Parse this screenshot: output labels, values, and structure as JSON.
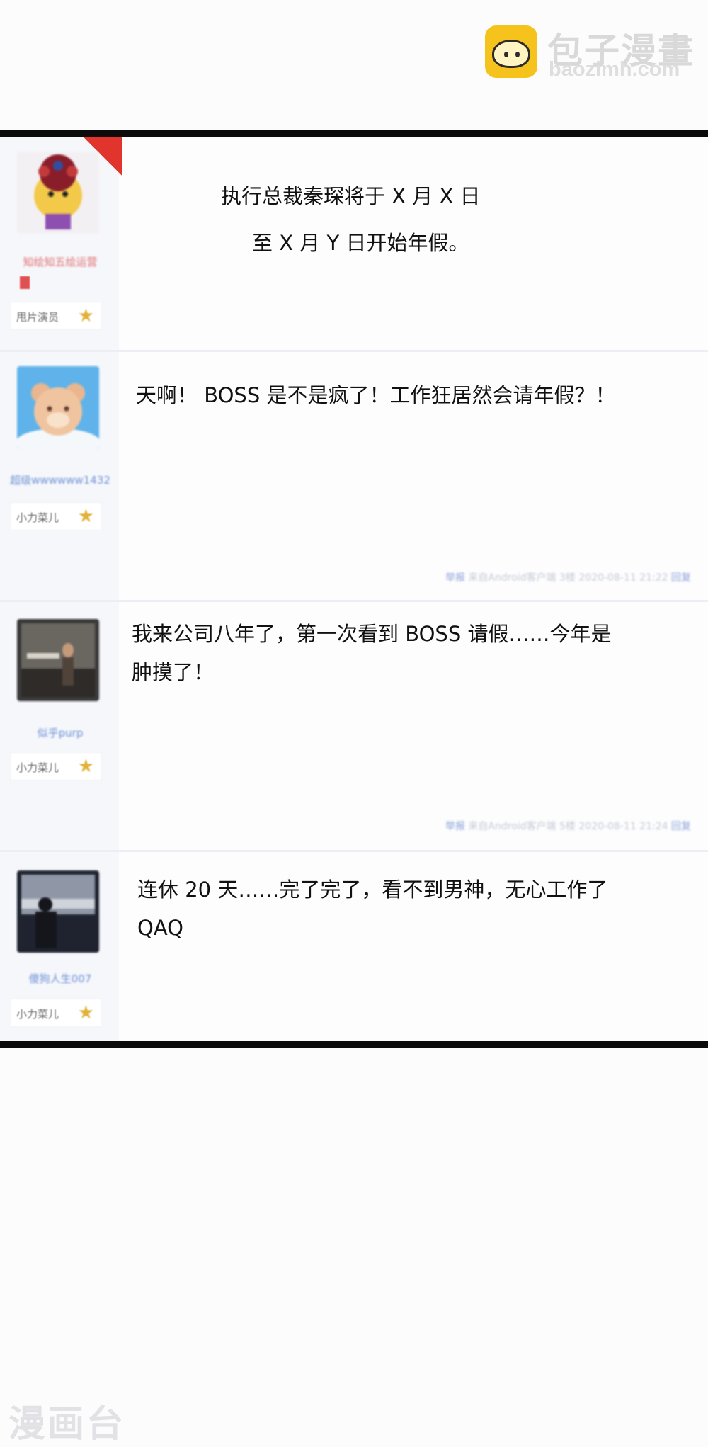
{
  "watermark": {
    "title": "包子漫畫",
    "url": "baozimh.com",
    "bottom_text": "漫画台"
  },
  "colors": {
    "frame": "#0b0b0b",
    "link_blue": "#6b8fd6",
    "star_gold": "#e2b13a",
    "corner_badge": "#e0342c",
    "logo_yellow": "#f6c21c"
  },
  "posts": [
    {
      "avatar_icon": "opera-mask-cartoon-avatar",
      "username": "知绘知五绘运营",
      "rank": "甩片演员",
      "lines": [
        "执行总裁秦琛将于 X 月 X 日",
        "至 X 月 Y 日开始年假。"
      ]
    },
    {
      "avatar_icon": "bear-cartoon-avatar",
      "username": "超级wwwwww1432",
      "rank": "小力菜儿",
      "lines": [
        "天啊！ BOSS 是不是疯了！工作狂居然会请年假？！"
      ],
      "meta": {
        "report": "举报",
        "source": "来自Android客户端",
        "floor": "3楼",
        "time": "2020-08-11 21:22",
        "reply": "回复"
      }
    },
    {
      "avatar_icon": "tomb-raider-photo-avatar",
      "username": "似乎purp",
      "rank": "小力菜儿",
      "lines": [
        "我来公司八年了，第一次看到 BOSS 请假……今年是",
        "肿摸了！"
      ],
      "meta": {
        "report": "举报",
        "source": "来自Android客户端",
        "floor": "5楼",
        "time": "2020-08-11 21:24",
        "reply": "回复"
      }
    },
    {
      "avatar_icon": "silhouette-photo-avatar",
      "username": "傻狗人生007",
      "rank": "小力菜儿",
      "lines": [
        "连休 20 天……完了完了，看不到男神，无心工作了",
        "QAQ"
      ]
    }
  ]
}
